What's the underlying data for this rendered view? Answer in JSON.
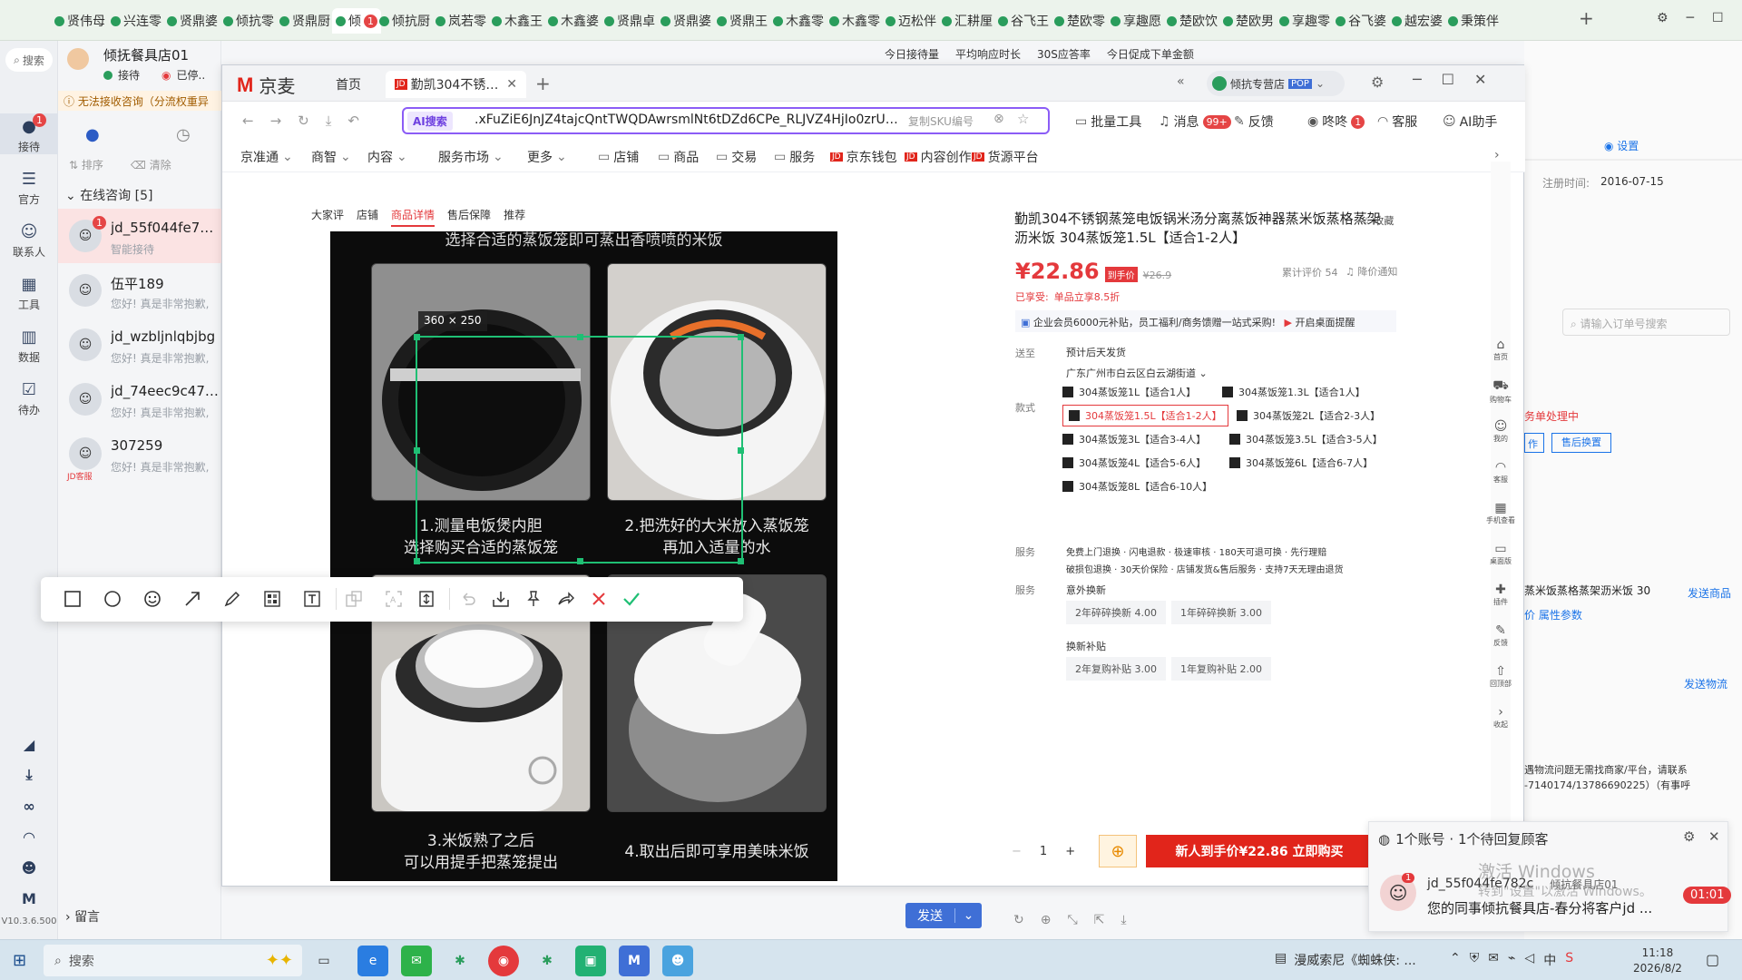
{
  "browser_tabs": [
    "贤伟母",
    "兴连零",
    "贤鼎婆",
    "倾抗零",
    "贤鼎厨",
    "倾",
    "倾抗厨",
    "岚若零",
    "木鑫王",
    "木鑫婆",
    "贤鼎卓",
    "贤鼎婆",
    "贤鼎王",
    "木鑫零",
    "木鑫零",
    "迈松伴",
    "汇耕厘",
    "谷飞王",
    "楚欧零",
    "享趣愿",
    "楚欧饮",
    "楚欧男",
    "享趣零",
    "谷飞婆",
    "越宏婆",
    "秉策伴"
  ],
  "active_tab_badge": "1",
  "shop": {
    "name": "倾抚餐具店01",
    "status_reception": "接待",
    "status_busy": "已停..",
    "notice": "无法接收咨询（分流权重异"
  },
  "search_label": "搜索",
  "left_nav": [
    {
      "label": "接待",
      "icon": "chat-icon",
      "badge": "1"
    },
    {
      "label": "官方",
      "icon": "message-icon"
    },
    {
      "label": "联系人",
      "icon": "person-icon"
    },
    {
      "label": "工具",
      "icon": "grid-icon"
    },
    {
      "label": "数据",
      "icon": "chart-icon"
    },
    {
      "label": "待办",
      "icon": "todo-icon"
    }
  ],
  "left_nav_bottom_icons": [
    "megaphone-icon",
    "download-icon",
    "link-icon",
    "headset-icon",
    "robot-icon",
    "logo-m-icon"
  ],
  "version": "V10.3.6.500",
  "consult": {
    "sort_label": "排序",
    "clear_label": "清除",
    "online_label": "在线咨询 [5]",
    "conversations": [
      {
        "name": "jd_55f044fe782c",
        "msg": "智能接待",
        "badge": "1"
      },
      {
        "name": "伍平189",
        "msg": "您好! 真是非常抱歉,"
      },
      {
        "name": "jd_wzbljnlqbjbg",
        "msg": "您好! 真是非常抱歉,"
      },
      {
        "name": "jd_74eec9c47611",
        "msg": "您好! 真是非常抱歉,"
      },
      {
        "name": "307259",
        "msg": "您好! 真是非常抱歉,",
        "tag": "JD客服"
      }
    ],
    "leave_msg": "留言"
  },
  "stats_row": [
    "今日接待量",
    "平均响应时长",
    "30S应答率",
    "今日促成下单金额"
  ],
  "jd_window": {
    "logo": "京麦",
    "tabs": [
      "首页",
      "勤凯304不锈钢蒸"
    ],
    "url_prefix": "AI搜索",
    "url_text": ".xFuZiE6JnJZ4tajcQntTWQDAwrsmlNt6tDZd6CPe_RLJVZ4HjIo0zrUWCY",
    "url_hint": "复制SKU编号",
    "store_tag": "倾抗专营店",
    "store_badge": "POP",
    "toolbar": [
      {
        "label": "批量工具",
        "icon": "tool-icon"
      },
      {
        "label": "消息",
        "icon": "bell-icon",
        "badge": "99+"
      },
      {
        "label": "反馈",
        "icon": "pen-icon"
      },
      {
        "label": "咚咚",
        "icon": "chat-icon",
        "badge": "1"
      },
      {
        "label": "客服",
        "icon": "headset-icon"
      },
      {
        "label": "AI助手",
        "icon": "ai-icon"
      }
    ],
    "menu": [
      "京准通",
      "商智",
      "内容",
      "服务市场",
      "更多"
    ],
    "menu_links": [
      "店铺",
      "商品",
      "交易",
      "服务",
      "京东钱包",
      "内容创作",
      "货源平台"
    ]
  },
  "product_tabs": [
    "大家评",
    "店铺",
    "商品详情",
    "售后保障",
    "推荐"
  ],
  "gallery": {
    "header_caption": "选择合适的蒸饭笼即可蒸出香喷喷的米饭",
    "captions": [
      [
        "1.测量电饭煲内胆",
        "选择购买合适的蒸饭笼"
      ],
      [
        "2.把洗好的大米放入蒸饭笼",
        "再加入适量的水"
      ],
      [
        "3.米饭熟了之后",
        "可以用提手把蒸笼提出"
      ],
      [
        "4.取出后即可享用美味米饭"
      ]
    ]
  },
  "product": {
    "title": "勤凯304不锈钢蒸笼电饭锅米汤分离蒸饭神器蒸米饭蒸格蒸架沥米饭 304蒸饭笼1.5L【适合1-2人】",
    "favorite": "收藏",
    "price": "¥22.86",
    "price_tag": "到手价",
    "orig_price": "¥26.9",
    "reviews": "累计评价 54",
    "price_alert": "降价通知",
    "promo_label": "已享受:",
    "promo_value": "单品立享8.5折",
    "enterprise": "企业会员6000元补贴，员工福利/商务馈赠一站式采购!",
    "enterprise_link": "开启桌面提醒",
    "ship_label": "送至",
    "ship_time": "预计后天发货",
    "ship_addr": "广东广州市白云区白云湖街道",
    "spec_label": "款式",
    "specs": [
      [
        "304蒸饭笼1L【适合1人】",
        "304蒸饭笼1.3L【适合1人】"
      ],
      [
        "304蒸饭笼1.5L【适合1-2人】",
        "304蒸饭笼2L【适合2-3人】"
      ],
      [
        "304蒸饭笼3L【适合3-4人】",
        "304蒸饭笼3.5L【适合3-5人】"
      ],
      [
        "304蒸饭笼4L【适合5-6人】",
        "304蒸饭笼6L【适合6-7人】"
      ],
      [
        "304蒸饭笼8L【适合6-10人】"
      ]
    ],
    "service_label": "服务",
    "service_line1": "免费上门退换 · 闪电退款 · 极速审核 · 180天可退可换 · 先行理赔",
    "service_line2": "破损包退换 · 30天价保险 · 店铺发货&售后服务 · 支持7天无理由退货",
    "extra_label": "服务",
    "extra_title": "意外换新",
    "extra_chips": [
      "2年碎碎换新 4.00",
      "1年碎碎换新 3.00"
    ],
    "subsidy_title": "换新补贴",
    "subsidy_chips": [
      "2年复购补贴 3.00",
      "1年复购补贴 2.00"
    ],
    "qty": "1",
    "buy_label": "新人到手价¥22.86 立即购买"
  },
  "side_tools": [
    "首页",
    "购物车",
    "我的",
    "客服",
    "手机查看",
    "桌面版",
    "插件",
    "反馈",
    "回顶部",
    "收起"
  ],
  "right_panel": {
    "settings": "设置",
    "reg_label": "注册时间:",
    "reg_date": "2016-07-15",
    "order_search": "请输入订单号搜索",
    "after_sale": "务单处理中",
    "btn1": "作",
    "btn2": "售后换置",
    "item_title": "蒸米饭蒸格蒸架沥米饭 30",
    "send_product": "发送商品",
    "attr_params": "属性参数",
    "send_logistics": "发送物流",
    "logistics_text": "遇物流问题无需找商家/平台，请联系 -7140174/13786690225）（有事呼"
  },
  "selection_size": "360 × 250",
  "send_btn": "发送",
  "notification": {
    "header": "1个账号 · 1个待回复顾客",
    "name": "jd_55f044fe782c",
    "shop": "倾抗餐具店01",
    "text": "您的同事倾抗餐具店-春分将客户jd ...",
    "timer": "01:01",
    "watermark1": "激活 Windows",
    "watermark2": "转到\"设置\"以激活 Windows。"
  },
  "taskbar": {
    "search": "搜索",
    "media": "漫威索尼《蜘蛛侠: ...",
    "ime": "中",
    "time": "11:18",
    "date": "2026/8/2"
  },
  "colors": {
    "accent": "#e4393c",
    "jd_red": "#e1251b",
    "selection": "#1fbf74",
    "ai_purple": "#8b5cf6"
  }
}
